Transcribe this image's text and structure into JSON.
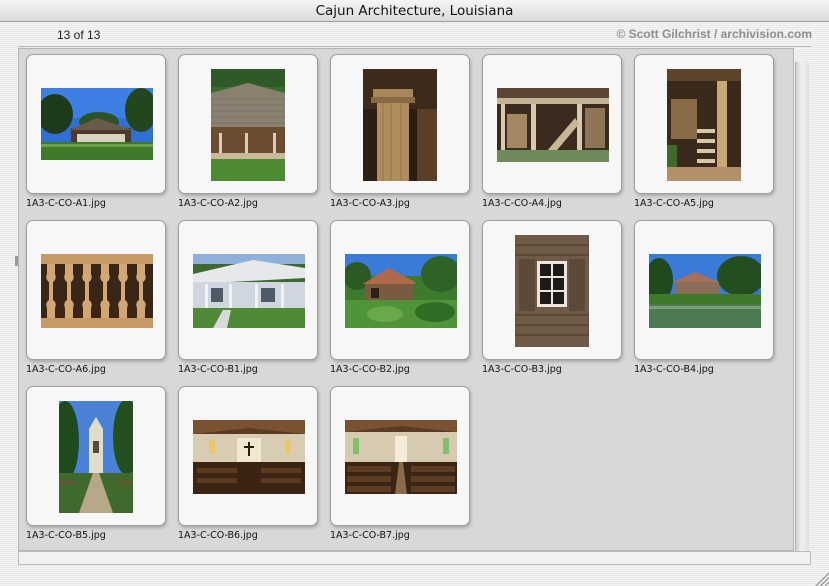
{
  "window": {
    "title": "Cajun Architecture, Louisiana"
  },
  "header": {
    "counter": "13 of 13",
    "credit": "© Scott Gilchrist / archivision.com"
  },
  "images": [
    {
      "file": "1A3-C-CO-A1.jpg"
    },
    {
      "file": "1A3-C-CO-A2.jpg"
    },
    {
      "file": "1A3-C-CO-A3.jpg"
    },
    {
      "file": "1A3-C-CO-A4.jpg"
    },
    {
      "file": "1A3-C-CO-A5.jpg"
    },
    {
      "file": "1A3-C-CO-A6.jpg"
    },
    {
      "file": "1A3-C-CO-B1.jpg"
    },
    {
      "file": "1A3-C-CO-B2.jpg"
    },
    {
      "file": "1A3-C-CO-B3.jpg"
    },
    {
      "file": "1A3-C-CO-B4.jpg"
    },
    {
      "file": "1A3-C-CO-B5.jpg"
    },
    {
      "file": "1A3-C-CO-B6.jpg"
    },
    {
      "file": "1A3-C-CO-B7.jpg"
    }
  ]
}
